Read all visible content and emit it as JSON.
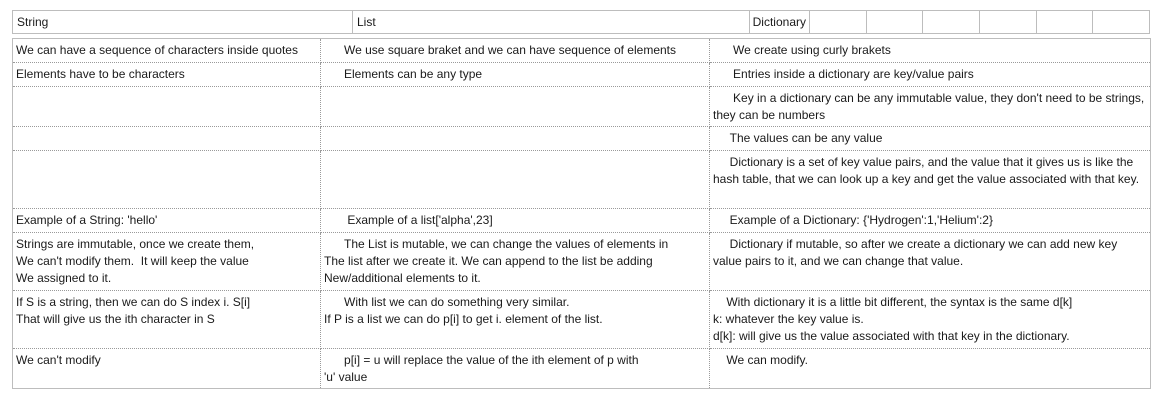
{
  "header": {
    "string_label": "String",
    "list_label": "List",
    "dictionary_label": "Dictionary"
  },
  "rows": [
    {
      "string": "We can have a sequence of characters inside quotes",
      "list": "      We use square braket and we can have sequence of elements",
      "dictionary": "      We create using curly brakets"
    },
    {
      "string": "Elements have to be characters",
      "list": "      Elements can be any type",
      "dictionary": "      Entries inside a dictionary are key/value pairs"
    },
    {
      "string": "",
      "list": "",
      "dictionary": "      Key in a dictionary can be any immutable value, they don't need to be strings, they can be numbers"
    },
    {
      "string": "",
      "list": "",
      "dictionary": "     The values can be any value"
    },
    {
      "string": "",
      "list": "",
      "dictionary": "     Dictionary is a set of key value pairs, and the value that it gives us is like the hash table, that we can look up a key and get the value associated with that key."
    },
    {
      "string": "Example of a String: 'hello'",
      "list": "       Example of a list['alpha',23]",
      "dictionary": "     Example of a Dictionary: {'Hydrogen':1,'Helium':2}"
    },
    {
      "string": "Strings are immutable, once we create them,\nWe can't modify them.  It will keep the value\nWe assigned to it.",
      "list": "      The List is mutable, we can change the values of elements in\nThe list after we create it. We can append to the list be adding\nNew/additional elements to it.",
      "dictionary": "     Dictionary if mutable, so after we create a dictionary we can add new key value pairs to it, and we can change that value."
    },
    {
      "string": "If S is a string, then we can do S index i. S[i]\nThat will give us the ith character in S",
      "list": "      With list we can do something very similar.\nIf P is a list we can do p[i] to get i. element of the list.",
      "dictionary": "    With dictionary it is a little bit different, the syntax is the same d[k]\nk: whatever the key value is.\nd[k]: will give us the value associated with that key in the dictionary."
    },
    {
      "string": "We can't modify",
      "list": "      p[i] = u will replace the value of the ith element of p with\n'u' value",
      "dictionary": "    We can modify."
    }
  ]
}
